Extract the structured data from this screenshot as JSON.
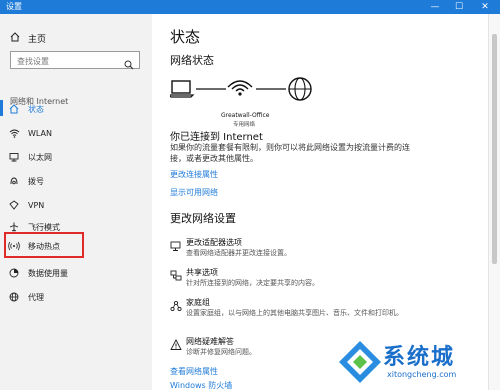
{
  "window": {
    "title": "设置",
    "minimize": "—",
    "maximize": "☐",
    "close": "✕"
  },
  "sidebar": {
    "home_label": "主页",
    "search_placeholder": "查找设置",
    "section_title": "网络和 Internet",
    "items": [
      {
        "label": "状态",
        "icon": "home-icon",
        "active": true
      },
      {
        "label": "WLAN",
        "icon": "wifi-icon"
      },
      {
        "label": "以太网",
        "icon": "ethernet-icon"
      },
      {
        "label": "拨号",
        "icon": "dialup-icon"
      },
      {
        "label": "VPN",
        "icon": "vpn-icon"
      },
      {
        "label": "飞行模式",
        "icon": "airplane-icon"
      },
      {
        "label": "移动热点",
        "icon": "hotspot-icon",
        "highlighted": true
      },
      {
        "label": "数据使用量",
        "icon": "data-usage-icon"
      },
      {
        "label": "代理",
        "icon": "globe-icon"
      }
    ]
  },
  "main": {
    "title": "状态",
    "network_status_title": "网络状态",
    "network_name": "Greatwall-Office",
    "network_type": "专用网络",
    "connected_title": "你已连接到 Internet",
    "connected_desc": "如果你的流量套餐有限制，则你可以将此网络设置为按流量计费的连接，或者更改其他属性。",
    "change_connection_link": "更改连接属性",
    "show_networks_link": "显示可用网络",
    "change_settings_title": "更改网络设置",
    "options": [
      {
        "title": "更改适配器选项",
        "desc": "查看网络适配器并更改连接设置。",
        "icon": "adapter-icon"
      },
      {
        "title": "共享选项",
        "desc": "针对所连接到的网络，决定要共享的内容。",
        "icon": "sharing-icon"
      },
      {
        "title": "家庭组",
        "desc": "设置家庭组，以与网络上的其他电脑共享图片、音乐、文件和打印机。",
        "icon": "homegroup-icon"
      },
      {
        "title": "网络疑难解答",
        "desc": "诊断并修复网络问题。",
        "icon": "warning-icon"
      }
    ],
    "view_properties_link": "查看网络属性",
    "firewall_link": "Windows 防火墙"
  },
  "watermark": {
    "brand": "系统城",
    "url": "xitongcheng.com"
  },
  "colors": {
    "accent": "#1f7bd8",
    "highlight": "#e02a2a",
    "sidebar_bg": "#f2f2f2"
  }
}
